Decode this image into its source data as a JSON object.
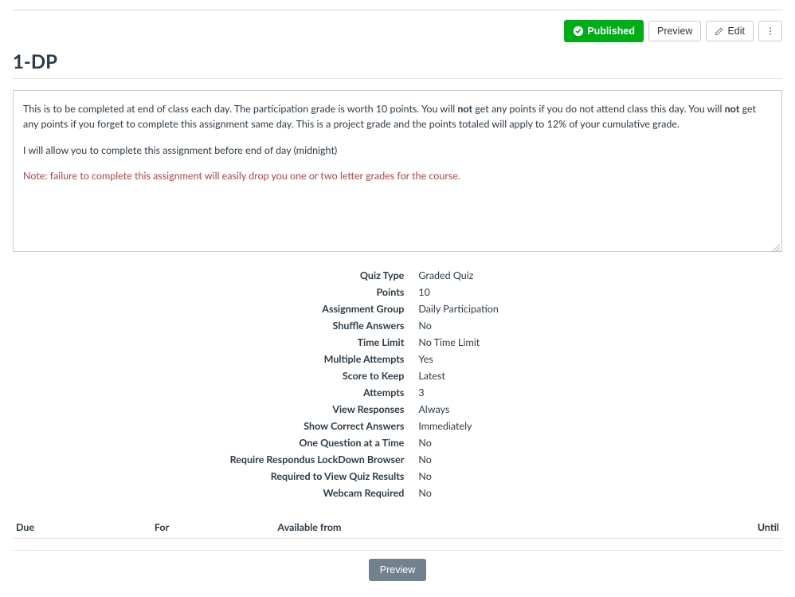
{
  "toolbar": {
    "published_label": "Published",
    "preview_label": "Preview",
    "edit_label": "Edit"
  },
  "page_title": "1-DP",
  "description": {
    "p1_a": "This is to be completed at end of class each day.  The participation grade is worth 10 points.   You will ",
    "p1_not1": "not",
    "p1_b": " get any points if you do not attend class this day.  You will ",
    "p1_not2": "not",
    "p1_c": " get any points if you forget to complete this assignment same day.  This is a project grade and the points totaled will apply to 12% of  your cumulative grade.",
    "p2": "I will allow you to complete this assignment before end of day (midnight)",
    "p3": "Note: failure to complete this assignment will easily drop you one or two letter grades for the course."
  },
  "settings": [
    {
      "label": "Quiz Type",
      "value": "Graded Quiz"
    },
    {
      "label": "Points",
      "value": "10"
    },
    {
      "label": "Assignment Group",
      "value": "Daily Participation"
    },
    {
      "label": "Shuffle Answers",
      "value": "No"
    },
    {
      "label": "Time Limit",
      "value": "No Time Limit"
    },
    {
      "label": "Multiple Attempts",
      "value": "Yes"
    },
    {
      "label": "Score to Keep",
      "value": "Latest"
    },
    {
      "label": "Attempts",
      "value": "3"
    },
    {
      "label": "View Responses",
      "value": "Always"
    },
    {
      "label": "Show Correct Answers",
      "value": "Immediately"
    },
    {
      "label": "One Question at a Time",
      "value": "No"
    },
    {
      "label": "Require Respondus LockDown Browser",
      "value": "No"
    },
    {
      "label": "Required to View Quiz Results",
      "value": "No"
    },
    {
      "label": "Webcam Required",
      "value": "No"
    }
  ],
  "due_headers": {
    "due": "Due",
    "for": "For",
    "available_from": "Available from",
    "until": "Until"
  },
  "footer": {
    "preview_label": "Preview"
  }
}
